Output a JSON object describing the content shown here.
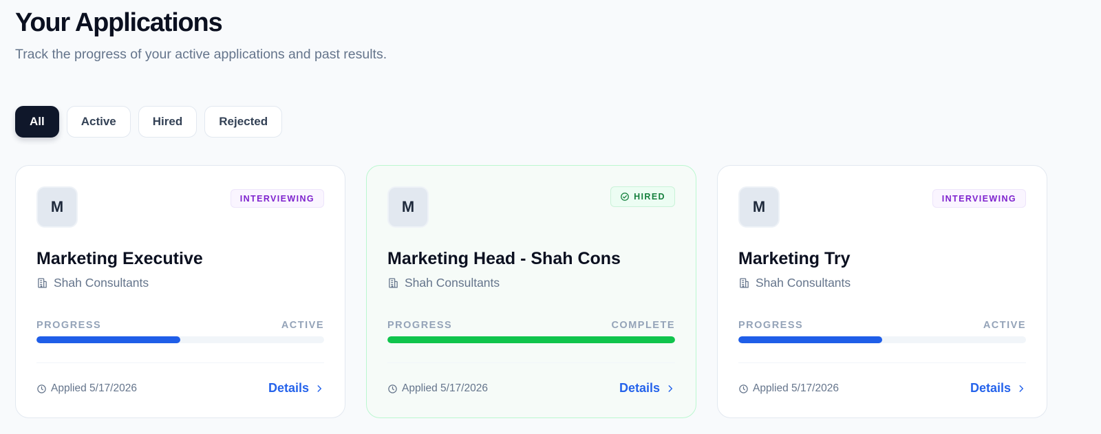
{
  "header": {
    "title": "Your Applications",
    "subtitle": "Track the progress of your active applications and past results."
  },
  "filters": [
    {
      "label": "All",
      "active": true
    },
    {
      "label": "Active",
      "active": false
    },
    {
      "label": "Hired",
      "active": false
    },
    {
      "label": "Rejected",
      "active": false
    }
  ],
  "colors": {
    "progress_active": "#1f5ee8",
    "progress_complete": "#10c44c",
    "interviewing_badge": "#7e22ce",
    "hired_badge": "#15803d",
    "details_link": "#2563eb"
  },
  "applications": [
    {
      "logo_letter": "M",
      "status": "INTERVIEWING",
      "title": "Marketing Executive",
      "company": "Shah Consultants",
      "progress_label": "PROGRESS",
      "progress_state": "ACTIVE",
      "progress_fraction": 0.5,
      "applied": "Applied 5/17/2026",
      "details_label": "Details",
      "icons": {
        "company": "building-icon",
        "applied": "clock-icon",
        "details": "chevron-right-icon"
      }
    },
    {
      "logo_letter": "M",
      "status": "HIRED",
      "title": "Marketing Head - Shah Cons",
      "company": "Shah Consultants",
      "progress_label": "PROGRESS",
      "progress_state": "COMPLETE",
      "progress_fraction": 1.0,
      "applied": "Applied 5/17/2026",
      "details_label": "Details",
      "icons": {
        "status": "check-circle-icon",
        "company": "building-icon",
        "applied": "clock-icon",
        "details": "chevron-right-icon"
      }
    },
    {
      "logo_letter": "M",
      "status": "INTERVIEWING",
      "title": "Marketing Try",
      "company": "Shah Consultants",
      "progress_label": "PROGRESS",
      "progress_state": "ACTIVE",
      "progress_fraction": 0.5,
      "applied": "Applied 5/17/2026",
      "details_label": "Details",
      "icons": {
        "company": "building-icon",
        "applied": "clock-icon",
        "details": "chevron-right-icon"
      }
    }
  ]
}
